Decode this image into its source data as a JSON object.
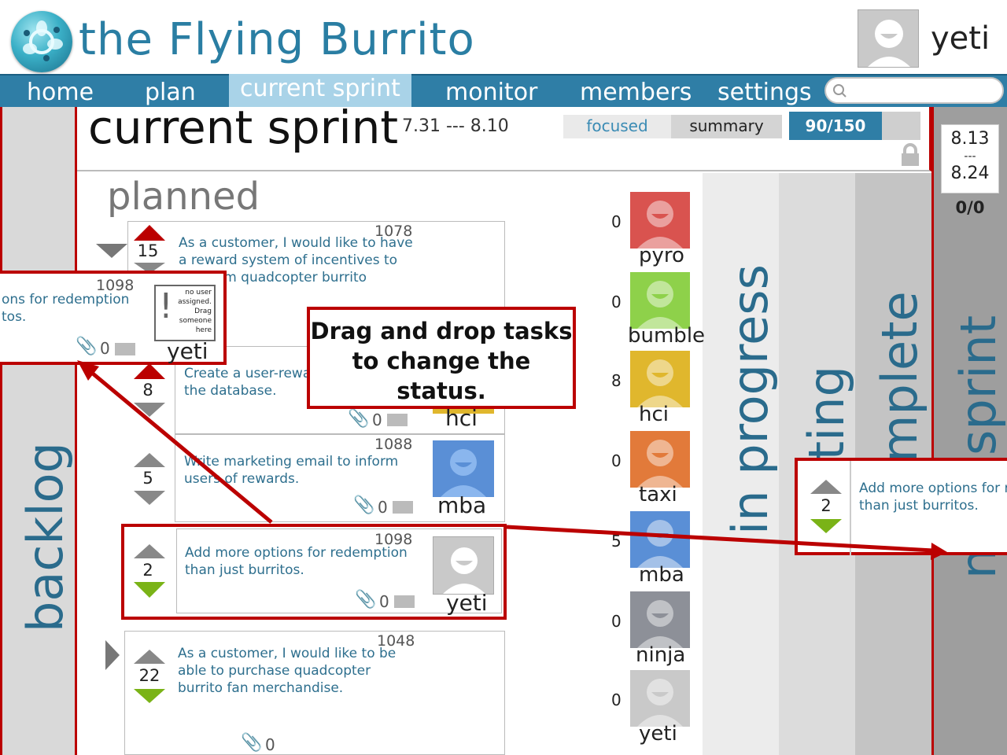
{
  "app": {
    "title": "the Flying Burrito",
    "user": "yeti"
  },
  "nav": {
    "home": "home",
    "plan": "plan",
    "current": "current sprint",
    "monitor": "monitor",
    "members": "members",
    "settings": "settings"
  },
  "sprint": {
    "title": "current sprint",
    "dates": "7.31 --- 8.10",
    "tab_focused": "focused",
    "tab_summary": "summary",
    "points": "90/150",
    "next_dates_start": "8.13",
    "next_dates_sep": "---",
    "next_dates_end": "8.24",
    "next_points": "0/0"
  },
  "columns": {
    "backlog": "backlog",
    "planned": "planned",
    "in_progress": "in progress",
    "testing": "testing",
    "complete": "complete",
    "next": "next sprint"
  },
  "colors": {
    "accent": "#2f7ea6",
    "callout": "#bb0000",
    "up_red": "#b00000",
    "down_green": "#7ab317",
    "gray_arrow": "#8c8c8c"
  },
  "tasks": [
    {
      "id": "1078",
      "points": "15",
      "desc1": "As a customer, I would like to have",
      "desc2": "a reward system of  incentives to",
      "desc3": "...m quadcopter burrito"
    },
    {
      "id": "",
      "points": "8",
      "desc1": "Create a user-rewa",
      "desc2": "the database.",
      "attachments": "0",
      "assignee": "hci"
    },
    {
      "id": "1088",
      "points": "5",
      "desc1": "Write marketing email to inform",
      "desc2": "users of  rewards.",
      "attachments": "0",
      "assignee": "mba"
    },
    {
      "id": "1098",
      "points": "2",
      "desc1": "Add more options for redemption",
      "desc2": "than just burritos.",
      "attachments": "0",
      "assignee": "yeti"
    },
    {
      "id": "1048",
      "points": "22",
      "desc1": "As a customer, I would like to be",
      "desc2": "able to purchase quadcopter",
      "desc3": "burrito fan merchandise.",
      "attachments": "0"
    }
  ],
  "dragged_backlog": {
    "id": "1098",
    "desc1": "ons for redemption",
    "desc2": "tos.",
    "attachments": "0",
    "assignee": "yeti",
    "unassigned_1": "no user",
    "unassigned_2": "assigned.",
    "unassigned_3": "Drag",
    "unassigned_4": "someone",
    "unassigned_5": "here"
  },
  "dragged_next": {
    "points": "2",
    "desc1": "Add more options for r",
    "desc2": "than just burritos."
  },
  "callout": {
    "line1": "Drag and drop tasks",
    "line2": "to change the",
    "line3": "status."
  },
  "members": [
    {
      "name": "pyro",
      "count": "0",
      "color": "#d9534f"
    },
    {
      "name": "bumble",
      "count": "0",
      "color": "#8ed14a"
    },
    {
      "name": "hci",
      "count": "8",
      "color": "#e0b72d"
    },
    {
      "name": "taxi",
      "count": "0",
      "color": "#e27a3a"
    },
    {
      "name": "mba",
      "count": "5",
      "color": "#5a8fd6"
    },
    {
      "name": "ninja",
      "count": "0",
      "color": "#8d9098"
    },
    {
      "name": "yeti",
      "count": "0",
      "color": "#c9c9c9"
    }
  ]
}
